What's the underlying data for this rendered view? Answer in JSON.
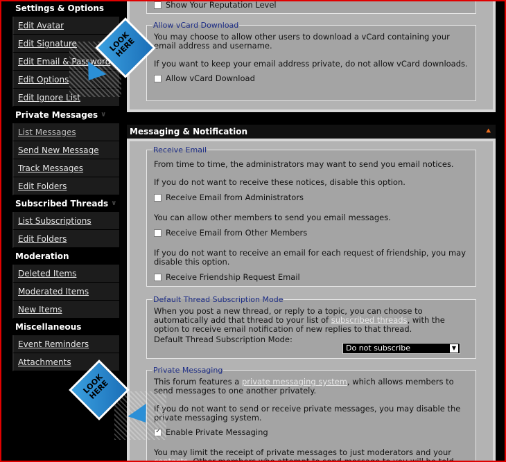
{
  "sidebar": {
    "groups": [
      {
        "title": "Settings & Options",
        "items": [
          "Edit Avatar",
          "Edit Signature",
          "Edit Email & Password",
          "Edit Options",
          "Edit Ignore List"
        ]
      },
      {
        "title": "Private Messages",
        "items": [
          "List Messages",
          "Send New Message",
          "Track Messages",
          "Edit Folders"
        ]
      },
      {
        "title": "Subscribed Threads",
        "items": [
          "List Subscriptions",
          "Edit Folders"
        ]
      },
      {
        "title": "Moderation",
        "items": [
          "Deleted Items",
          "Moderated Items",
          "New Items"
        ]
      },
      {
        "title": "Miscellaneous",
        "items": [
          "Event Reminders",
          "Attachments"
        ]
      }
    ]
  },
  "top_panel": {
    "reputation_label": "Show Your Reputation Level",
    "vcard_legend": "Allow vCard Download",
    "vcard_text1": "You may choose to allow other users to download a vCard containing your email address and username.",
    "vcard_text2": "If you want to keep your email address private, do not allow vCard downloads.",
    "vcard_checkbox": "Allow vCard Download"
  },
  "messaging": {
    "section_title": "Messaging & Notification",
    "collapse_icon": "double-chevron-up",
    "receive_email": {
      "legend": "Receive Email",
      "text1": "From time to time, the administrators may want to send you email notices.",
      "text2": "If you do not want to receive these notices, disable this option.",
      "cb1": "Receive Email from Administrators",
      "text3": "You can allow other members to send you email messages.",
      "cb2": "Receive Email from Other Members",
      "text4": "If you do not want to receive an email for each request of friendship, you may disable this option.",
      "cb3": "Receive Friendship Request Email"
    },
    "subscription": {
      "legend": "Default Thread Subscription Mode",
      "text_pre": "When you post a new thread, or reply to a topic, you can choose to automatically add that thread to your list of ",
      "text_link": "subscribed threads",
      "text_post": ", with the option to receive email notification of new replies to that thread.",
      "mode_label": "Default Thread Subscription Mode:",
      "mode_value": "Do not subscribe"
    },
    "pm": {
      "legend": "Private Messaging",
      "text_pre": "This forum features a ",
      "text_link": "private messaging system",
      "text_post": ", which allows members to send messages to one another privately.",
      "text2": "If you do not want to send or receive private messages, you may disable the private messaging system.",
      "cb": "Enable Private Messaging",
      "text3_pre": "You may limit the receipt of private messages to just moderators and your ",
      "text3_link": "contacts",
      "text3_post": ". Other members who attempt to send message to you will be told"
    }
  },
  "stickers": {
    "label": "LOOK HERE",
    "color": "#2b8fd6"
  }
}
